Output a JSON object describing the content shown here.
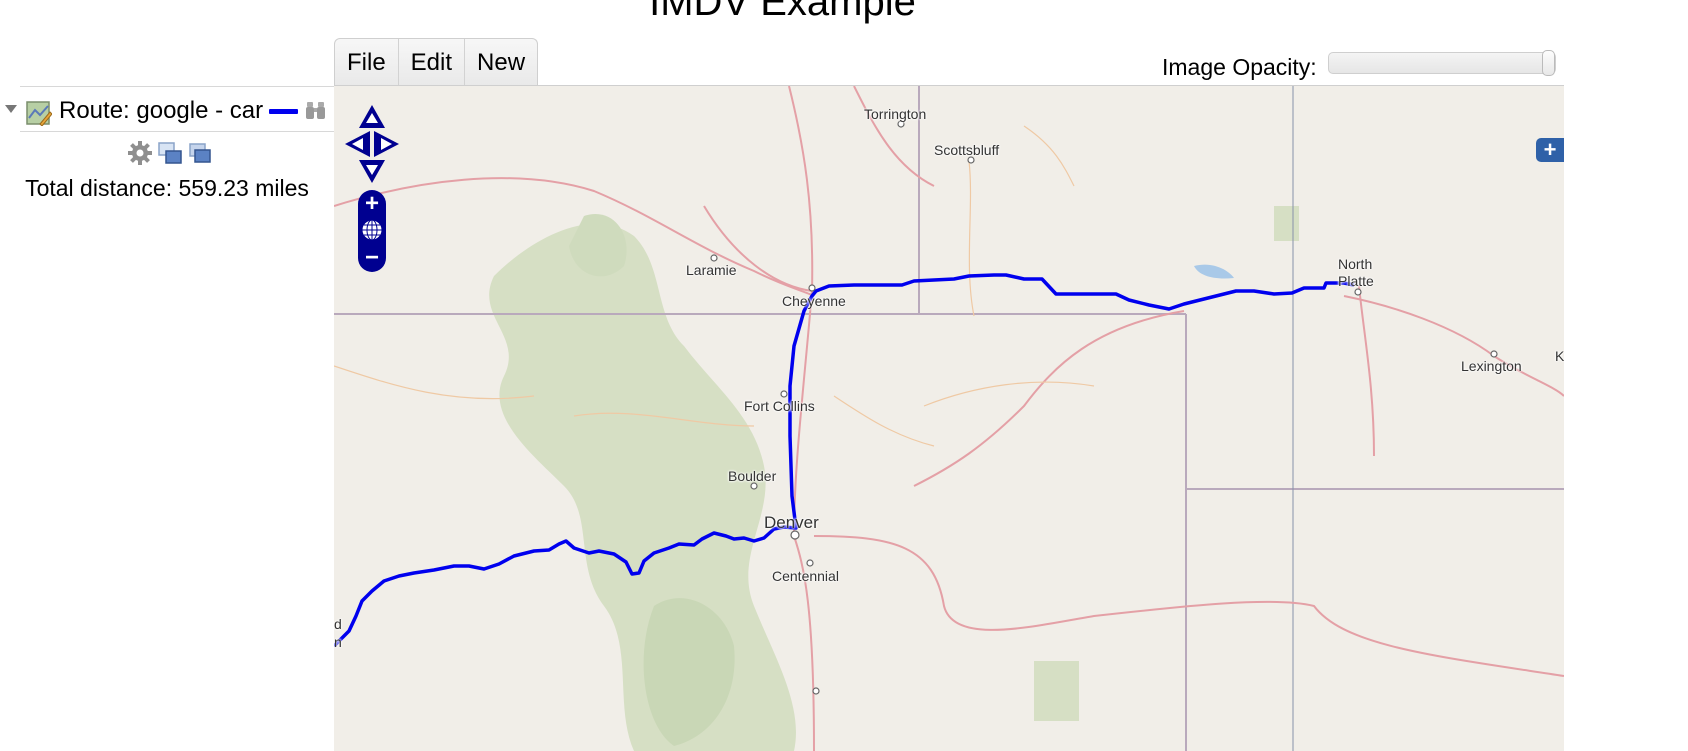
{
  "page": {
    "title": "IMDV Example"
  },
  "menu": {
    "items": [
      {
        "label": "File"
      },
      {
        "label": "Edit"
      },
      {
        "label": "New"
      }
    ]
  },
  "opacity": {
    "label": "Image Opacity:",
    "value": 1.0
  },
  "layer_panel": {
    "layer": {
      "name": "Route: google - car",
      "route_color": "#0000ee"
    },
    "tools": [
      {
        "icon": "gear-icon"
      },
      {
        "icon": "duplicate-icon"
      },
      {
        "icon": "stack-icon"
      }
    ],
    "total_distance": "Total distance: 559.23 miles"
  },
  "map": {
    "places": [
      "Torrington",
      "Scottsbluff",
      "Laramie",
      "Cheyenne",
      "North",
      "Platte",
      "Lexington",
      "Fort Collins",
      "Boulder",
      "Denver",
      "Centennial",
      "K",
      "d",
      "n"
    ],
    "controls": {
      "zoom_in": "+",
      "zoom_out": "−",
      "layer_switcher": "+"
    }
  }
}
